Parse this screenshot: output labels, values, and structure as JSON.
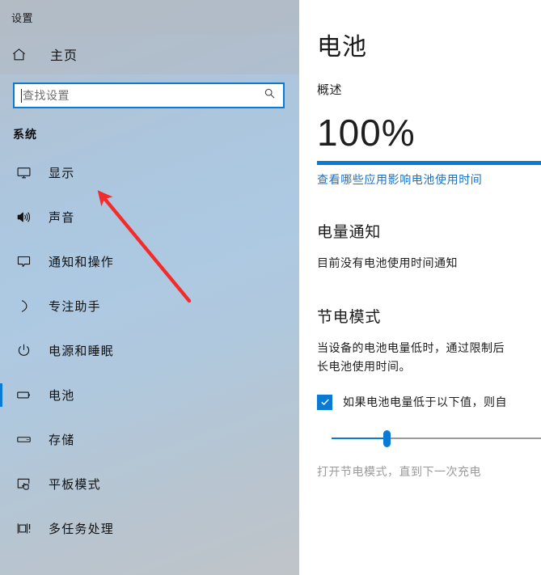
{
  "window": {
    "title": "设置"
  },
  "sidebar": {
    "home": {
      "label": "主页",
      "icon": "home-icon"
    },
    "search": {
      "placeholder": "查找设置",
      "value": "",
      "icon": "search-icon"
    },
    "section_label": "系统",
    "items": [
      {
        "label": "显示",
        "icon": "monitor-icon",
        "selected": false
      },
      {
        "label": "声音",
        "icon": "speaker-icon",
        "selected": false
      },
      {
        "label": "通知和操作",
        "icon": "notification-icon",
        "selected": false
      },
      {
        "label": "专注助手",
        "icon": "moon-icon",
        "selected": false
      },
      {
        "label": "电源和睡眠",
        "icon": "power-icon",
        "selected": false
      },
      {
        "label": "电池",
        "icon": "battery-icon",
        "selected": true
      },
      {
        "label": "存储",
        "icon": "storage-icon",
        "selected": false
      },
      {
        "label": "平板模式",
        "icon": "tablet-mode-icon",
        "selected": false
      },
      {
        "label": "多任务处理",
        "icon": "multitasking-icon",
        "selected": false
      }
    ]
  },
  "content": {
    "page_title": "电池",
    "overview_label": "概述",
    "battery_percent": "100%",
    "battery_level": 100,
    "battery_link": "查看哪些应用影响电池使用时间",
    "notifications": {
      "heading": "电量通知",
      "body": "目前没有电池使用时间通知"
    },
    "battery_saver": {
      "heading": "节电模式",
      "description_line1": "当设备的电池电量低时，通过限制后",
      "description_line2": "长电池使用时间。",
      "checkbox_label": "如果电池电量低于以下值，则自",
      "checkbox_checked": true,
      "slider_value": 20,
      "footer_note": "打开节电模式，直到下一次充电"
    }
  },
  "colors": {
    "accent": "#0a7bd4",
    "link": "#1a72c4",
    "annotation": "#f42b2b",
    "sidebar_top": "#b7c0c9",
    "sidebar_mid": "#adc9e2",
    "sidebar_bottom": "#bfc4c9"
  },
  "annotation": {
    "type": "arrow",
    "color": "#f42b2b",
    "points_to": "显示"
  }
}
